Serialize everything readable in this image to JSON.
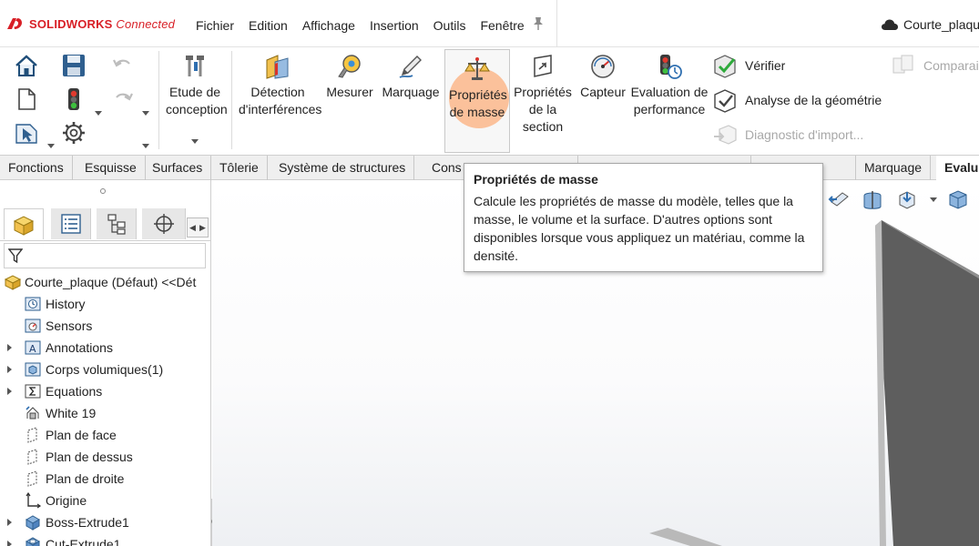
{
  "app": {
    "logo_brand": "SOLIDWORKS",
    "logo_suffix": "Connected",
    "brand_color": "#d81f26"
  },
  "menu": [
    "Fichier",
    "Edition",
    "Affichage",
    "Insertion",
    "Outils",
    "Fenêtre"
  ],
  "document_title": "Courte_plaque",
  "ribbon": {
    "etude": "Etude de conception",
    "detection": "Détection d'interférences",
    "mesurer": "Mesurer",
    "marquage": "Marquage",
    "proprietes_masse": "Propriétés de masse",
    "proprietes_section": "Propriétés de la section",
    "capteur": "Capteur",
    "evaluation": "Evaluation de performance",
    "verifier": "Vérifier",
    "analyse": "Analyse de la géométrie",
    "diagnostic": "Diagnostic d'import...",
    "compare": "Comparais",
    "highlight_color": "#ff9650"
  },
  "tabs": [
    "Fonctions",
    "Esquisse",
    "Surfaces",
    "Tôlerie",
    "Système de structures",
    "Cons",
    "",
    "",
    "",
    "Marquage",
    "Evalu"
  ],
  "tooltip": {
    "title": "Propriétés de masse",
    "body": "Calcule les propriétés de masse du modèle, telles que la masse, le volume et la surface. D'autres options sont disponibles lorsque vous appliquez un matériau, comme la densité."
  },
  "tree": {
    "root": "Courte_plaque (Défaut) <<Dét",
    "items": [
      "History",
      "Sensors",
      "Annotations",
      "Corps volumiques(1)",
      "Equations",
      "White 19",
      "Plan de face",
      "Plan de dessus",
      "Plan de droite",
      "Origine",
      "Boss-Extrude1",
      "Cut-Extrude1"
    ]
  }
}
